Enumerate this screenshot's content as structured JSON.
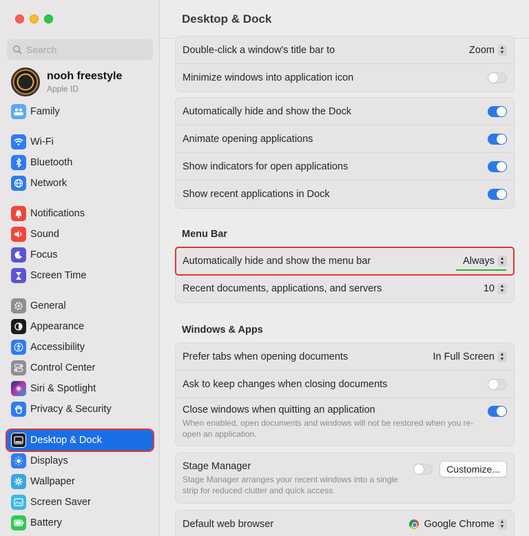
{
  "sidebar": {
    "search_placeholder": "Search",
    "profile": {
      "name": "nooh freestyle",
      "subtitle": "Apple ID"
    },
    "items": [
      {
        "label": "Family"
      },
      {
        "label": "Wi-Fi"
      },
      {
        "label": "Bluetooth"
      },
      {
        "label": "Network"
      },
      {
        "label": "Notifications"
      },
      {
        "label": "Sound"
      },
      {
        "label": "Focus"
      },
      {
        "label": "Screen Time"
      },
      {
        "label": "General"
      },
      {
        "label": "Appearance"
      },
      {
        "label": "Accessibility"
      },
      {
        "label": "Control Center"
      },
      {
        "label": "Siri & Spotlight"
      },
      {
        "label": "Privacy & Security"
      },
      {
        "label": "Desktop & Dock"
      },
      {
        "label": "Displays"
      },
      {
        "label": "Wallpaper"
      },
      {
        "label": "Screen Saver"
      },
      {
        "label": "Battery"
      }
    ]
  },
  "main": {
    "title": "Desktop & Dock",
    "group1": {
      "rows": [
        {
          "label": "Double-click a window's title bar to",
          "value": "Zoom"
        },
        {
          "label": "Minimize windows into application icon"
        }
      ]
    },
    "group2": {
      "rows": [
        {
          "label": "Automatically hide and show the Dock"
        },
        {
          "label": "Animate opening applications"
        },
        {
          "label": "Show indicators for open applications"
        },
        {
          "label": "Show recent applications in Dock"
        }
      ]
    },
    "menu_bar": {
      "title": "Menu Bar",
      "rows": [
        {
          "label": "Automatically hide and show the menu bar",
          "value": "Always"
        },
        {
          "label": "Recent documents, applications, and servers",
          "value": "10"
        }
      ]
    },
    "windows_apps": {
      "title": "Windows & Apps",
      "rows": [
        {
          "label": "Prefer tabs when opening documents",
          "value": "In Full Screen"
        },
        {
          "label": "Ask to keep changes when closing documents"
        },
        {
          "label": "Close windows when quitting an application",
          "description": "When enabled, open documents and windows will not be restored when you re-open an application."
        }
      ]
    },
    "stage_manager": {
      "label": "Stage Manager",
      "description": "Stage Manager arranges your recent windows into a single strip for reduced clutter and quick access.",
      "button": "Customize..."
    },
    "default_browser": {
      "label": "Default web browser",
      "value": "Google Chrome"
    }
  },
  "colors": {
    "accent": "#2a7ae6",
    "selection": "#1b6fe6",
    "highlight_box": "#e1372c",
    "underline": "#3aa84a"
  }
}
